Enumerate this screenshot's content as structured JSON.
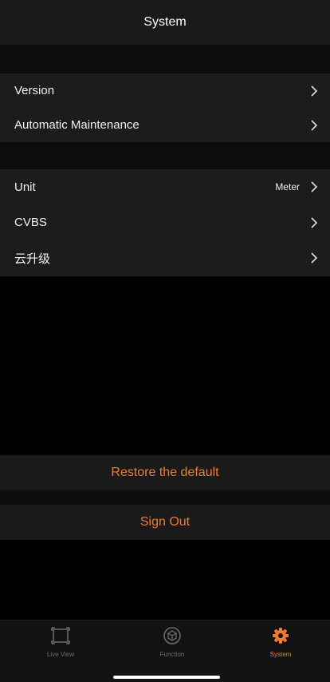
{
  "header": {
    "title": "System"
  },
  "group1": {
    "items": [
      {
        "label": "Version",
        "value": ""
      },
      {
        "label": "Automatic Maintenance",
        "value": ""
      }
    ]
  },
  "group2": {
    "items": [
      {
        "label": "Unit",
        "value": "Meter"
      },
      {
        "label": "CVBS",
        "value": ""
      },
      {
        "label": "云升级",
        "value": ""
      }
    ]
  },
  "actions": {
    "restore_label": "Restore the default",
    "signout_label": "Sign Out"
  },
  "tabbar": {
    "tabs": [
      {
        "label": "Live View",
        "icon": "live-view-icon",
        "active": false
      },
      {
        "label": "Function",
        "icon": "function-cube-icon",
        "active": false
      },
      {
        "label": "System",
        "icon": "gear-icon",
        "active": true
      }
    ]
  },
  "colors": {
    "accent": "#f07b30",
    "background": "#000000",
    "cell": "#1c1c1c",
    "inactive_tab": "#6e6e6e"
  }
}
